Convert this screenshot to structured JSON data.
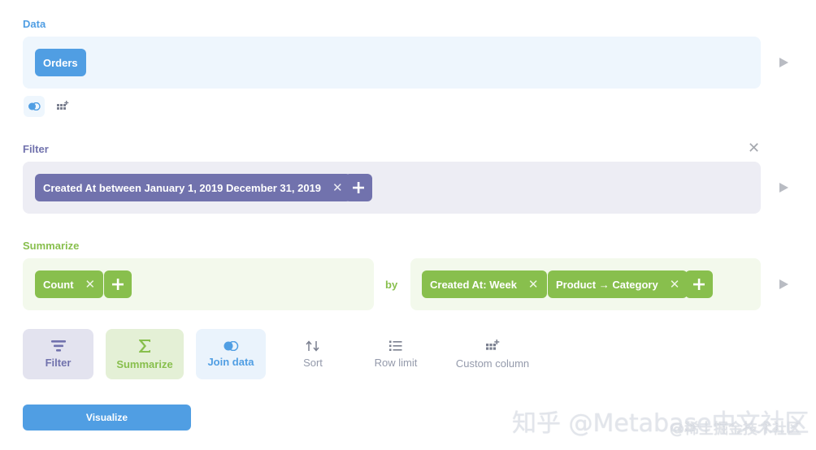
{
  "sections": {
    "data_label": "Data",
    "filter_label": "Filter",
    "summarize_label": "Summarize"
  },
  "data_step": {
    "table": "Orders"
  },
  "filter_step": {
    "filters": [
      "Created At between January 1, 2019 December 31, 2019"
    ]
  },
  "summarize_step": {
    "metrics": [
      "Count"
    ],
    "by_label": "by",
    "breakouts": [
      "Created At: Week",
      "Product → Category"
    ]
  },
  "actions": {
    "filter": "Filter",
    "summarize": "Summarize",
    "join": "Join data",
    "sort": "Sort",
    "row_limit": "Row limit",
    "custom_column": "Custom column"
  },
  "visualize_label": "Visualize",
  "watermark": {
    "line1": "知乎 @Metabase中文社区",
    "line2": "@稀土掘金技术社区"
  },
  "colors": {
    "data": "#509ee3",
    "filter": "#7172ad",
    "summarize": "#88bf4d"
  },
  "icons": {
    "join": "join-icon",
    "custom_column": "custom-column-icon",
    "filter": "filter-icon",
    "summarize": "sigma-icon",
    "sort": "sort-icon",
    "row_limit": "list-icon",
    "add": "plus-icon",
    "remove": "close-icon",
    "run": "play-icon"
  }
}
